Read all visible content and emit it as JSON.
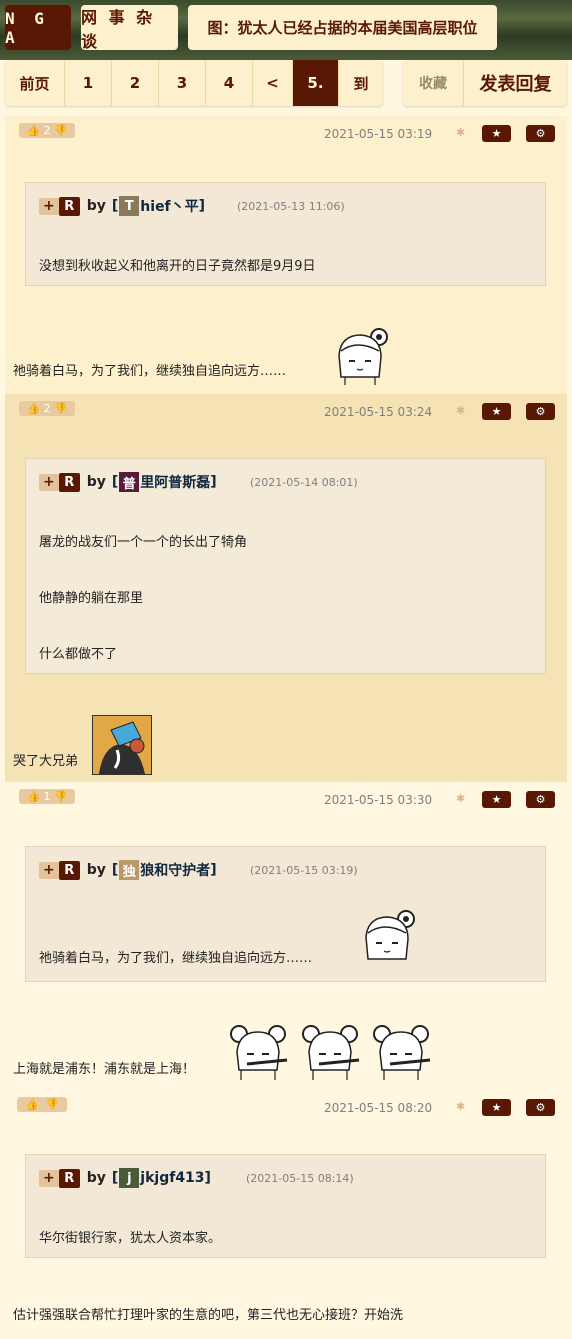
{
  "header": {
    "logo": "N G A",
    "forum": "网 事 杂 谈",
    "thread_title": "图：犹太人已经占据的本届美国高层职位"
  },
  "pager": {
    "first": "前页",
    "pages": [
      "1",
      "2",
      "3",
      "4"
    ],
    "prev": "<",
    "current": "5.",
    "goto": "到"
  },
  "actions": {
    "favorite": "收藏",
    "reply": "发表回复"
  },
  "posts": [
    {
      "likes": "2",
      "date": "2021-05-15 03:19",
      "quote": {
        "plus": "+",
        "r": "R",
        "by": "by",
        "user_initial": "T",
        "user_rest": "hief丶平",
        "date": "(2021-05-13 11:06)",
        "lines": [
          "没想到秋收起义和他离开的日子竟然都是9月9日"
        ]
      },
      "body": "祂骑着白马，为了我们，继续独自追向远方……"
    },
    {
      "likes": "2",
      "date": "2021-05-15 03:24",
      "quote": {
        "plus": "+",
        "r": "R",
        "by": "by",
        "user_initial": "普",
        "user_rest": "里阿普斯磊",
        "date": "(2021-05-14 08:01)",
        "lines": [
          "屠龙的战友们一个一个的长出了犄角",
          "他静静的躺在那里",
          "什么都做不了"
        ]
      },
      "body": "哭了大兄弟"
    },
    {
      "likes": "1",
      "date": "2021-05-15 03:30",
      "quote": {
        "plus": "+",
        "r": "R",
        "by": "by",
        "user_initial": "独",
        "user_rest": "狼和守护者",
        "date": "(2021-05-15 03:19)",
        "lines": [
          "祂骑着白马，为了我们，继续独自追向远方……"
        ]
      },
      "body": "上海就是浦东！浦东就是上海！"
    },
    {
      "likes": "",
      "date": "2021-05-15 08:20",
      "quote": {
        "plus": "+",
        "r": "R",
        "by": "by",
        "user_initial": "j",
        "user_rest": "jkjgf413",
        "date": "(2021-05-15 08:14)",
        "lines": [
          "华尔街银行家，犹太人资本家。"
        ]
      },
      "body": "估计强强联合帮忙打理叶家的生意的吧，第三代也无心接班？开始洗"
    }
  ]
}
